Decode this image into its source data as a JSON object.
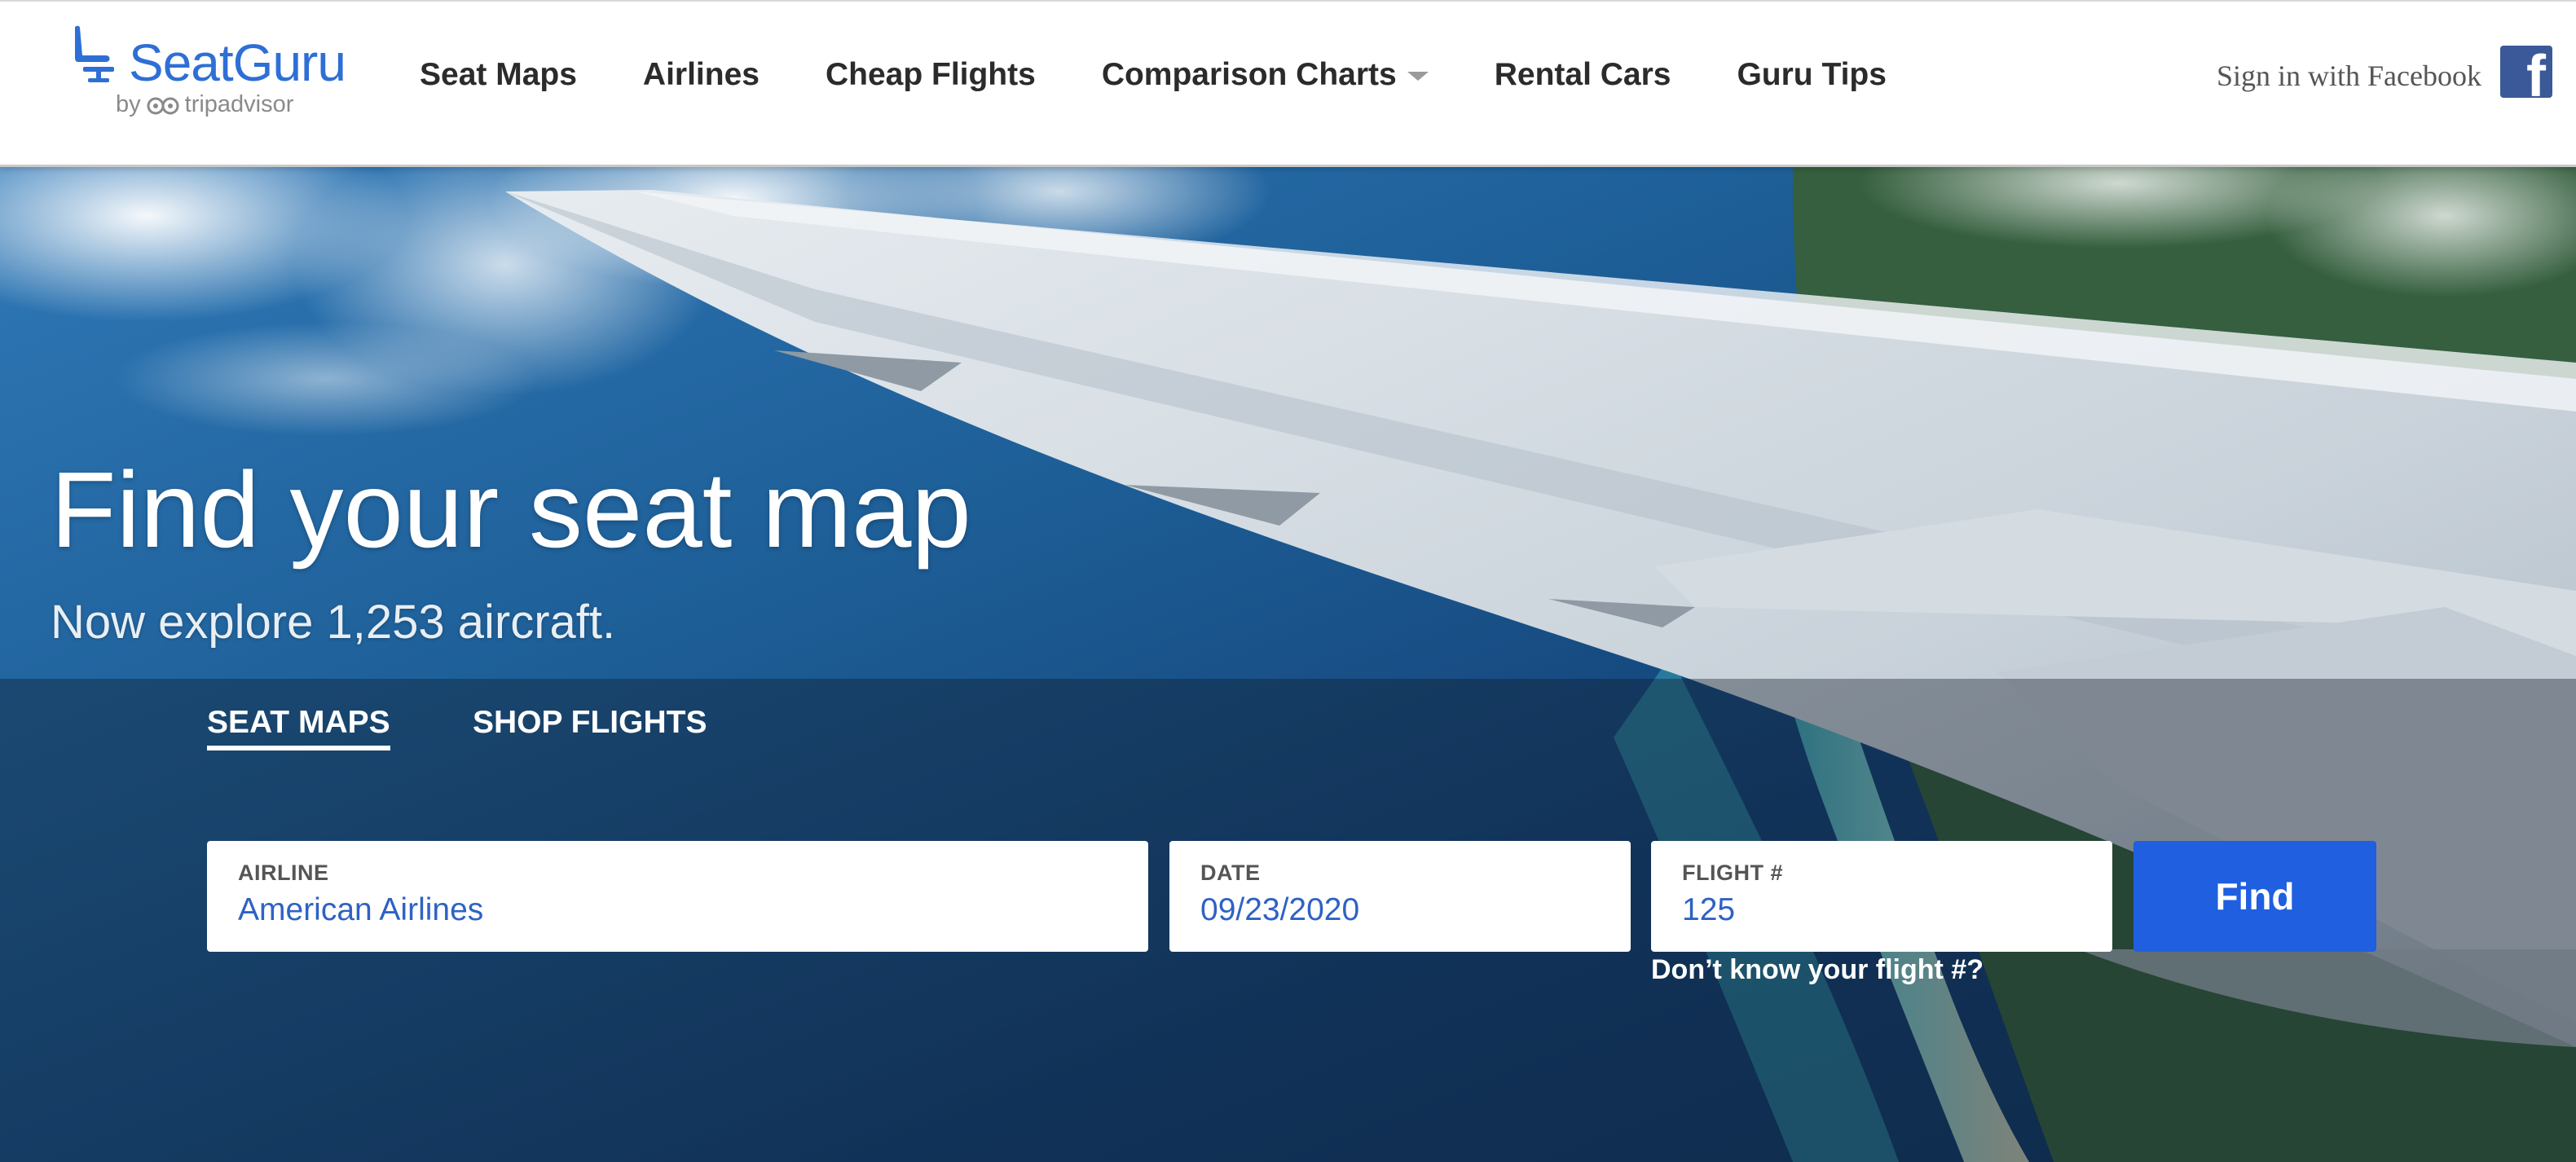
{
  "header": {
    "logo_text": "SeatGuru",
    "logo_by": "by",
    "logo_partner": "tripadvisor",
    "nav": [
      {
        "label": "Seat Maps"
      },
      {
        "label": "Airlines"
      },
      {
        "label": "Cheap Flights"
      },
      {
        "label": "Comparison Charts",
        "has_dropdown": true
      },
      {
        "label": "Rental Cars"
      },
      {
        "label": "Guru Tips"
      }
    ],
    "sign_in": "Sign in with Facebook",
    "facebook_icon": "facebook-icon"
  },
  "hero": {
    "title": "Find your seat map",
    "subtitle": "Now explore 1,253 aircraft."
  },
  "search": {
    "tabs": [
      {
        "label": "SEAT MAPS",
        "active": true
      },
      {
        "label": "SHOP FLIGHTS",
        "active": false
      }
    ],
    "fields": {
      "airline": {
        "label": "AIRLINE",
        "value": "American Airlines"
      },
      "date": {
        "label": "DATE",
        "value": "09/23/2020"
      },
      "flight": {
        "label": "FLIGHT #",
        "value": "125"
      }
    },
    "find_label": "Find",
    "help_link": "Don’t know your flight #?"
  },
  "colors": {
    "brand_blue": "#2e6fd6",
    "button_blue": "#1f5fe0",
    "facebook_blue": "#3b5998"
  }
}
